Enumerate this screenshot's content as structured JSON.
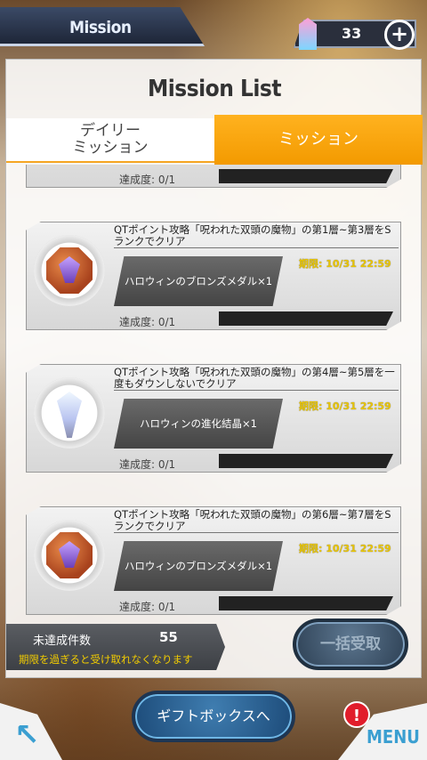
{
  "header": {
    "title": "Mission",
    "currency_value": "33",
    "plus_label": "+"
  },
  "panel": {
    "title": "Mission List",
    "tabs": [
      {
        "label": "デイリー\nミッション",
        "active": false
      },
      {
        "label": "ミッション",
        "active": true
      }
    ]
  },
  "missions": [
    {
      "description": "",
      "reward": "",
      "deadline": "",
      "progress_label": "達成度: 0/1",
      "progress": 0,
      "icon": "partial-card"
    },
    {
      "description": "QTポイント攻略「呪われた双頭の魔物」の第1層~第3層をSランクでクリア",
      "reward": "ハロウィンのブロンズメダル×1",
      "deadline": "期限: 10/31 22:59",
      "progress_label": "達成度: 0/1",
      "progress": 0,
      "icon": "bronze-medal-icon"
    },
    {
      "description": "QTポイント攻略「呪われた双頭の魔物」の第4層~第5層を一度もダウンしないでクリア",
      "reward": "ハロウィンの進化結晶×1",
      "deadline": "期限: 10/31 22:59",
      "progress_label": "達成度: 0/1",
      "progress": 0,
      "icon": "evolution-crystal-icon"
    },
    {
      "description": "QTポイント攻略「呪われた双頭の魔物」の第6層~第7層をSランクでクリア",
      "reward": "ハロウィンのブロンズメダル×1",
      "deadline": "期限: 10/31 22:59",
      "progress_label": "達成度: 0/1",
      "progress": 0,
      "icon": "bronze-medal-icon"
    }
  ],
  "summary": {
    "label": "未達成件数",
    "count": "55",
    "note": "期限を過ぎると受け取れなくなります"
  },
  "buttons": {
    "bulk_receive": "一括受取",
    "gift_box": "ギフトボックスへ",
    "menu": "MENU",
    "alert": "!"
  },
  "colors": {
    "tab_active": "#f39a00",
    "deadline": "#e8c400",
    "note": "#f2cc00",
    "accent": "#3b9fd1"
  }
}
